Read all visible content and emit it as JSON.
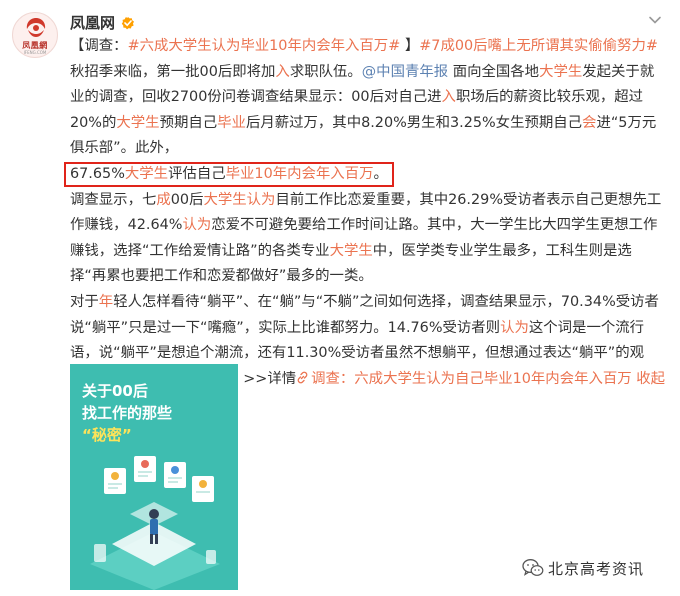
{
  "account": {
    "avatar_text": "凤凰網",
    "avatar_sub": "IFENG.COM",
    "name": "凤凰网",
    "verified_icon": "verified-badge-icon",
    "more_icon": "chevron-down-icon"
  },
  "post": {
    "line1": {
      "bracket_open": "【调查：",
      "hashtag1": "#六成大学生认为毕业10年内会年入百万#",
      "bracket_close": " 】",
      "hashtag2": "#7成00后嘴上无所谓其实偷偷努力#",
      "tail": " 秋"
    },
    "para1": [
      {
        "t": "招季来临，第一批00后即将加",
        "c": ""
      },
      {
        "t": "入",
        "c": "hl"
      },
      {
        "t": "求职队伍。",
        "c": ""
      },
      {
        "t": "@中国青年报",
        "c": "at"
      },
      {
        "t": " 面向全国各地",
        "c": ""
      },
      {
        "t": "大学生",
        "c": "hl"
      },
      {
        "t": "发起关于就业的调查，回收2700份问卷调查结果显示：00后对自己进",
        "c": ""
      },
      {
        "t": "入",
        "c": "hl"
      },
      {
        "t": "职场后的薪资比较乐观，超过20%的",
        "c": ""
      },
      {
        "t": "大学生",
        "c": "hl"
      },
      {
        "t": "预期自己",
        "c": ""
      },
      {
        "t": "毕业",
        "c": "hl"
      },
      {
        "t": "后月薪过万，其中8.20%男生和3.25%女生预期自己",
        "c": ""
      },
      {
        "t": "会",
        "c": "hl"
      },
      {
        "t": "进“5万元俱乐部”。此外，",
        "c": ""
      }
    ],
    "boxed": [
      {
        "t": "67.65%",
        "c": ""
      },
      {
        "t": "大学生",
        "c": "hl"
      },
      {
        "t": "评估自己",
        "c": ""
      },
      {
        "t": "毕业10年内会年入百万",
        "c": "hl"
      },
      {
        "t": "。",
        "c": ""
      }
    ],
    "para2": [
      {
        "t": "调查显示，七",
        "c": ""
      },
      {
        "t": "成",
        "c": "hl"
      },
      {
        "t": "00后",
        "c": ""
      },
      {
        "t": "大学生认为",
        "c": "hl"
      },
      {
        "t": "目前工作比恋爱重要，其中26.29%受访者表示自己更想先工作赚钱，42.64%",
        "c": ""
      },
      {
        "t": "认为",
        "c": "hl"
      },
      {
        "t": "恋爱不可避免要给工作时间让路。其中，大一学生比大四学生更想工作赚钱，选择“工作给爱情让路”的各类专业",
        "c": ""
      },
      {
        "t": "大学生",
        "c": "hl"
      },
      {
        "t": "中，医学类专业学生最多，工科生则是选择“再累也要把工作和恋爱都做好”最多的一类。",
        "c": ""
      }
    ],
    "para3": [
      {
        "t": "对于",
        "c": ""
      },
      {
        "t": "年",
        "c": "hl"
      },
      {
        "t": "轻人怎样看待“躺平”、在“躺”与“不躺”之间如何选择，调查结果显示，70.34%受访者说“躺平”只是过一下“嘴瘾”，实际上比谁都努力。14.76%受访者则",
        "c": ""
      },
      {
        "t": "认为",
        "c": "hl"
      },
      {
        "t": "这个词是一个流行语，说“躺平”是想追个潮流，还有11.30%受访者虽然不想躺平，但想通过表达“躺平”的观点、和其他网友“打辩论”。>>详情",
        "c": ""
      }
    ],
    "detail_link_icon": "link-icon",
    "detail_link_text": "调查：六成大学生认为自己毕业10年内会年入百万",
    "collapse_text": "收起全文",
    "collapse_icon": "chevron-up-icon"
  },
  "image": {
    "line1": "关于00后",
    "line2_a": "找工作的那些",
    "line2_b": "“秘密”"
  },
  "watermark": {
    "icon": "wechat-icon",
    "text": "北京高考资讯"
  }
}
